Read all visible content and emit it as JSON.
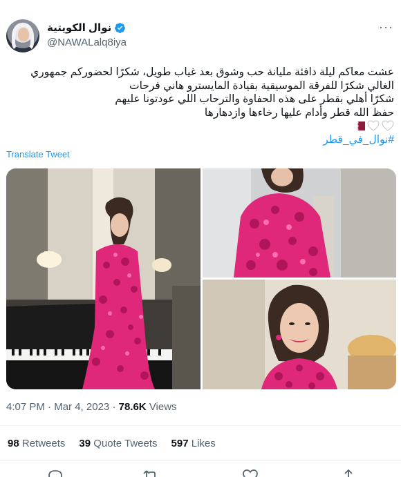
{
  "author": {
    "display_name": "نوال الكويتية",
    "handle": "@NAWALalq8iya"
  },
  "tweet": {
    "lines": [
      "عشت معاكم ليلة دافئة مليانة حب وشوق بعد غياب طويل، شكرًا لحضوركم جمهوري",
      "الغالي شكرًا للفرقة الموسيقية بقيادة المايسترو هاني فرحات",
      "شكرًا أهلي بقطر على هذه الحفاوة والترحاب اللي عودتونا عليهم",
      "حفظ الله قطر وأدام عليها رخاءها وازدهارها"
    ],
    "hashtag": "#نوال_في_قطر",
    "translate_label": "Translate Tweet"
  },
  "meta": {
    "time": "4:07 PM",
    "separator": "·",
    "date": "Mar 4, 2023",
    "views_count": "78.6K",
    "views_label": "Views"
  },
  "stats": {
    "retweets_count": "98",
    "retweets_label": "Retweets",
    "quotes_count": "39",
    "quotes_label": "Quote Tweets",
    "likes_count": "597",
    "likes_label": "Likes"
  },
  "icons": {
    "verified": "verified-badge-icon",
    "more": "more-icon",
    "heart": "white-heart-emoji",
    "flag": "qatar-flag-emoji",
    "reply": "reply-icon",
    "retweet": "retweet-icon",
    "like": "like-icon",
    "share": "share-icon"
  },
  "colors": {
    "link": "#1d9bf0",
    "secondary_text": "#536471",
    "primary_text": "#0f1419",
    "dress": "#e0287a",
    "qatar_maroon": "#8d1b3d"
  }
}
